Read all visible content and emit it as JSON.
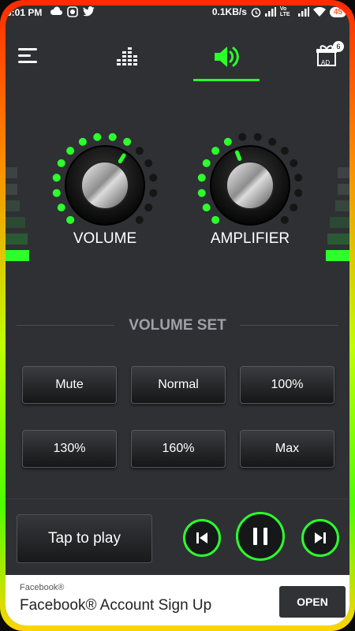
{
  "status_bar": {
    "time": "6:01 PM",
    "speed": "0.1KB/s",
    "network": "Vo LTE",
    "battery": "45"
  },
  "toolbar": {
    "menu_icon": "hamburger-icon",
    "equalizer_icon": "equalizer-icon",
    "volume_icon": "speaker-icon",
    "ad_badge": "6",
    "ad_label": "AD"
  },
  "knobs": {
    "volume": {
      "label": "VOLUME",
      "level": 0.62
    },
    "amplifier": {
      "label": "AMPLIFIER",
      "level": 0.42
    }
  },
  "volume_set": {
    "title": "VOLUME SET",
    "presets": [
      "Mute",
      "Normal",
      "100%",
      "130%",
      "160%",
      "Max"
    ]
  },
  "player": {
    "tap_label": "Tap to play",
    "prev_icon": "previous-icon",
    "pause_icon": "pause-icon",
    "next_icon": "next-icon"
  },
  "ad": {
    "brand": "Facebook®",
    "title": "Facebook® Account Sign Up",
    "button": "OPEN"
  },
  "colors": {
    "accent": "#2cff2c",
    "background": "#2e3034"
  }
}
